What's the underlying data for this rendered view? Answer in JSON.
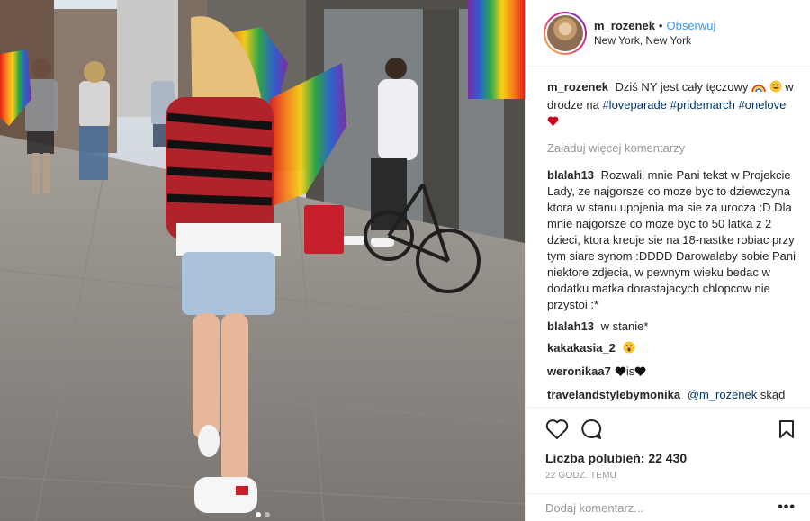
{
  "header": {
    "username": "m_rozenek",
    "separator": "•",
    "follow_label": "Obserwuj",
    "location": "New York, New York"
  },
  "caption": {
    "username": "m_rozenek",
    "text_before": "Dziś NY jest cały tęczowy",
    "text_after": "w drodze na",
    "hashtags": [
      "#loveparade",
      "#pridemarch",
      "#onelove"
    ]
  },
  "load_more_label": "Załaduj więcej komentarzy",
  "comments": [
    {
      "user": "blalah13",
      "text": "Rozwalil mnie Pani tekst w Projekcie Lady, ze najgorsze co moze byc to dziewczyna ktora w stanu upojenia ma sie za urocza :D Dla mnie najgorsze co moze byc to 50 latka z 2 dzieci, ktora kreuje sie na 18-nastke robiac przy tym siare synom :DDDD Darowalaby sobie Pani niektore zdjecia, w pewnym wieku bedac w dodatku matka dorastajacych chlopcow nie przystoi :*"
    },
    {
      "user": "blalah13",
      "text": "w stanie*"
    },
    {
      "user": "kakakasia_2",
      "text": ""
    },
    {
      "user": "weronikaa7",
      "text": "is"
    },
    {
      "user": "travelandstylebymonika",
      "mention": "@m_rozenek",
      "text": "skąd"
    }
  ],
  "likes": {
    "label": "Liczba polubień:",
    "count": "22 430"
  },
  "time_ago": "22 GODZ. TEMU",
  "add_comment": {
    "placeholder": "Dodaj komentarz..."
  },
  "more_label": "•••",
  "icons": [
    "heart-icon",
    "comment-icon",
    "bookmark-icon"
  ],
  "colors": {
    "link": "#003569",
    "follow": "#3897f0",
    "muted": "#999999"
  },
  "carousel": {
    "slides": 2,
    "active_index": 1
  }
}
